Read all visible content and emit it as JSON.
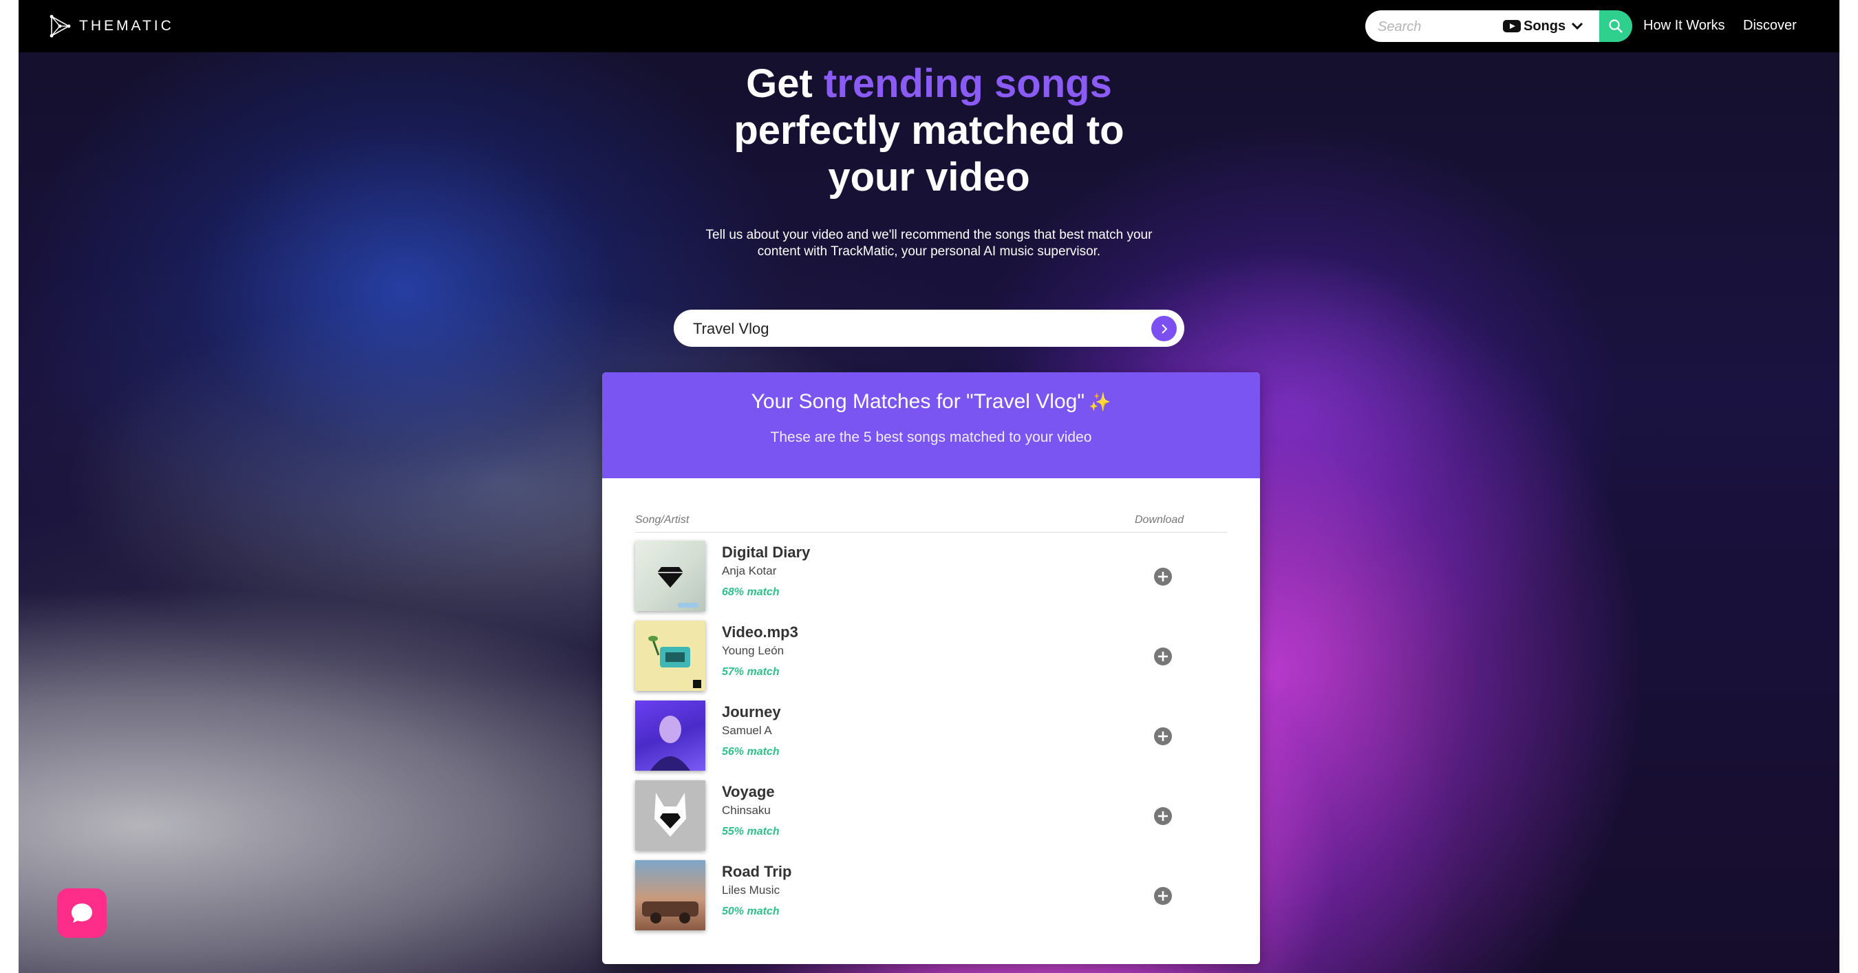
{
  "navbar": {
    "brand": "THEMATIC",
    "search_placeholder": "Search",
    "source_label": "Songs",
    "links": [
      "How It Works",
      "Discover"
    ]
  },
  "hero": {
    "title_word1": "Get",
    "title_accent": "trending songs",
    "title_rest": "perfectly matched to your video",
    "subtitle": "Tell us about your video and we'll recommend the songs that best match your content with TrackMatic, your personal AI music supervisor."
  },
  "prompt": {
    "value": "Travel Vlog"
  },
  "results": {
    "title": "Your Song Matches for \"Travel Vlog\"",
    "subtitle": "These are the 5 best songs matched to your video",
    "col_song": "Song/Artist",
    "col_download": "Download",
    "songs": [
      {
        "title": "Digital Diary",
        "artist": "Anja Kotar",
        "match": "68% match"
      },
      {
        "title": "Video.mp3",
        "artist": "Young León",
        "match": "57% match"
      },
      {
        "title": "Journey",
        "artist": "Samuel A",
        "match": "56% match"
      },
      {
        "title": "Voyage",
        "artist": "Chinsaku",
        "match": "55% match"
      },
      {
        "title": "Road Trip",
        "artist": "Liles Music",
        "match": "50% match"
      }
    ]
  },
  "icons": {
    "search": "search-icon",
    "youtube": "youtube-icon",
    "chevron": "chevron-down-icon",
    "submit": "chevron-right-icon",
    "download": "plus-circle-icon",
    "chat": "chat-icon"
  },
  "colors": {
    "accent_purple": "#7b55f2",
    "title_accent": "#8a5cf5",
    "search_green": "#2fcf8e",
    "match_green": "#2fbf89",
    "chat_pink": "#ff2d8a",
    "navbar": "#000000"
  }
}
